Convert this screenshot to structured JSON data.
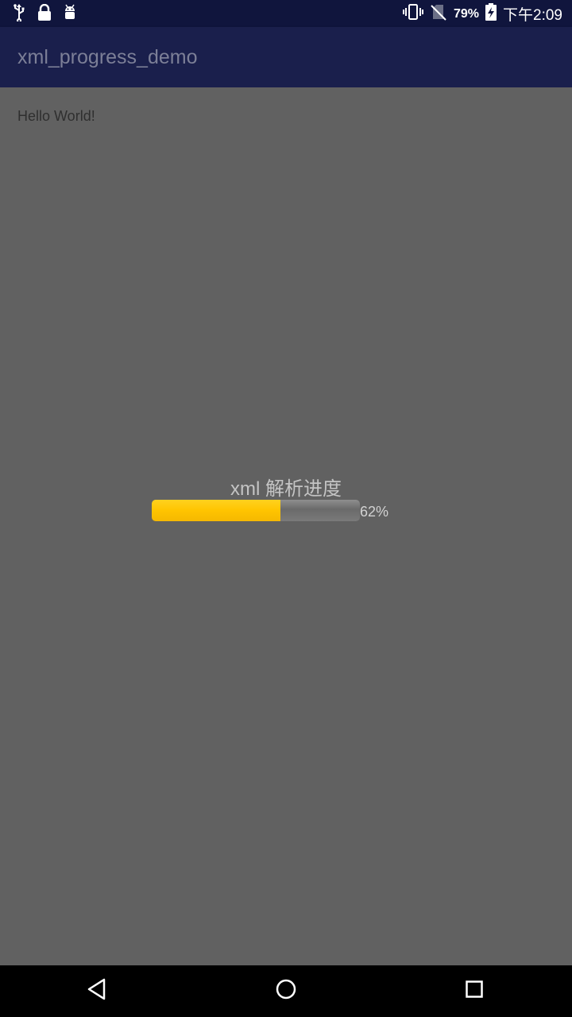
{
  "status_bar": {
    "time": "下午2:09",
    "battery_percent": "79%",
    "left_icons": [
      "usb-icon",
      "lock-icon",
      "android-debug-icon"
    ],
    "right_icons": [
      "vibrate-icon",
      "no-sim-icon",
      "battery-charging-icon"
    ]
  },
  "app_bar": {
    "title": "xml_progress_demo"
  },
  "main": {
    "hello_text": "Hello World!",
    "progress": {
      "label": "xml 解析进度",
      "value_text": "62%",
      "value": 0.62,
      "fill_color": "#ffc400",
      "track_color": "#7a7a7a"
    }
  },
  "nav_bar": {
    "buttons": [
      "back-icon",
      "home-icon",
      "recents-icon"
    ]
  }
}
